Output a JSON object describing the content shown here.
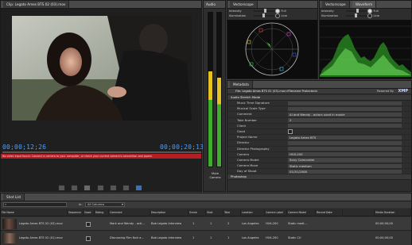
{
  "clip_panel": {
    "tab": "Clip: Legato Ames BTS 02 (03).mov",
    "timecode_left": "00;00;12;26",
    "timecode_right": "00;00;20;13",
    "error_text": "No video input found. Connect a camera to your computer, or check your current camera's connection and power."
  },
  "audio_panel": {
    "tab": "Audio",
    "label": "Mute\nCamera",
    "level_left": 0.62,
    "level_right": 0.58
  },
  "vectorscope": {
    "tab": "Vectorscope",
    "intensity_label": "Intensity",
    "illumination_label": "Illumination",
    "full_label": "Full",
    "line_label": "Line",
    "intensity_value": 0.55,
    "illumination_value": 0.45
  },
  "waveform": {
    "tabs": [
      "Vectorscope",
      "Waveform"
    ],
    "intensity_label": "Intensity",
    "illumination_label": "Illumination",
    "full_label": "Full",
    "line_label": "Line"
  },
  "metadata": {
    "tab": "Metadata",
    "file_label": "File: Legato Ames BTS 02 (03).mov<Filename Protected>",
    "powered_by": "Powered By",
    "brand": "XMP",
    "section_audio": "Audio Stretch Mode",
    "section_photoshop": "Photoshop",
    "rows": [
      {
        "key": "Music Time Signature",
        "value": ""
      },
      {
        "key": "Musical Scale Type",
        "value": ""
      },
      {
        "key": "Comment",
        "value": "Al and Wendy - actors used in movie"
      },
      {
        "key": "Take Number",
        "value": "2"
      },
      {
        "key": "Client",
        "value": ""
      },
      {
        "key": "Good",
        "value": ""
      },
      {
        "key": "Project Name",
        "value": "Legato Ames BTS"
      },
      {
        "key": "Director",
        "value": ""
      },
      {
        "key": "Director Photography",
        "value": ""
      },
      {
        "key": "Camera",
        "value": "HVX-200"
      },
      {
        "key": "Camera Model",
        "value": "Sony Camcorder"
      },
      {
        "key": "Camera Move",
        "value": "Static medium"
      },
      {
        "key": "Day of Shoot",
        "value": "01/31/2008"
      }
    ]
  },
  "shot_list": {
    "tab": "Shot List",
    "columns_select": "All Columns",
    "columns_label": "In:",
    "headers": [
      "File Name",
      "Sequence",
      "Good",
      "Rating",
      "Comment",
      "Description",
      "Scene",
      "Shot",
      "Take",
      "Location",
      "Camera Label",
      "Camera Model",
      "Record Date",
      "",
      "Media Duration"
    ],
    "rows": [
      {
        "file": "Legato Ames BTS 02 (03).mov",
        "comment": "Mark and Wendy - acti...",
        "description": "Bob Legato Interview",
        "scene": "1",
        "shot": "1",
        "take": "2",
        "location": "Los Angeles",
        "camera_label": "HVX-200",
        "camera_model": "Static medi...",
        "duration": "00;00;00;00"
      },
      {
        "file": "Legato Ames BTS 02 (01).mov",
        "comment": "Discussing Film Noir a...",
        "description": "Bob Legato Interview",
        "scene": "1",
        "shot": "1",
        "take": "1",
        "location": "Los Angeles",
        "camera_label": "HVX-200",
        "camera_model": "Static CU",
        "duration": "00;00;00;00"
      }
    ]
  },
  "colors": {
    "timecode": "#4d9fff",
    "error": "#b51f24",
    "scope_green": "#36c02b",
    "audio_yellow": "#e7c321",
    "audio_green": "#3fae2a"
  }
}
